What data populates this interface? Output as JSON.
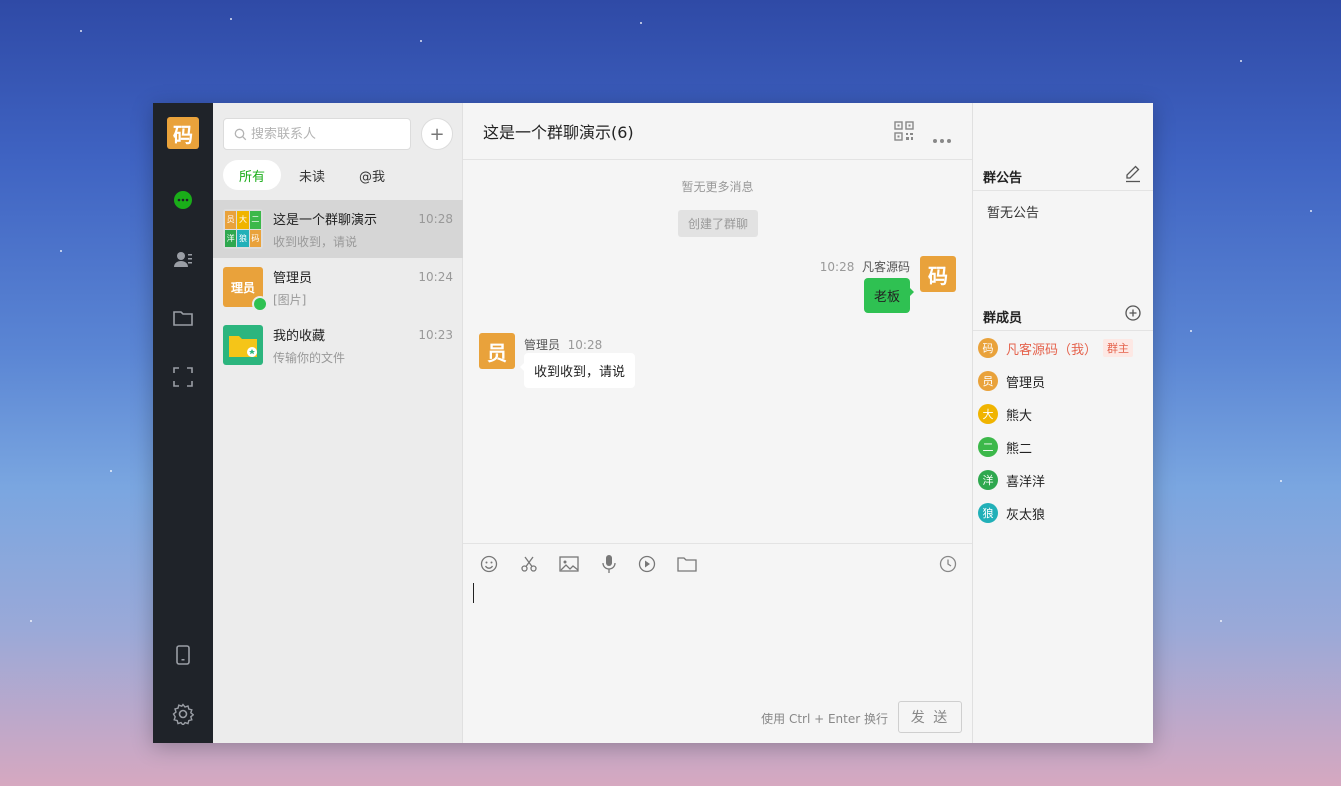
{
  "app": {
    "logo": "码"
  },
  "contacts": {
    "search_placeholder": "搜索联系人",
    "add": "+",
    "tabs": [
      "所有",
      "未读",
      "@我"
    ],
    "items": [
      {
        "name": "这是一个群聊演示",
        "preview": "收到收到，请说",
        "time": "10:28"
      },
      {
        "name": "管理员",
        "preview": "[图片]",
        "time": "10:24",
        "avatar_text": "理员"
      },
      {
        "name": "我的收藏",
        "preview": "传输你的文件",
        "time": "10:23"
      }
    ],
    "group_avatar_chars": [
      "员",
      "大",
      "二",
      "洋",
      "狼",
      "码"
    ]
  },
  "chat": {
    "title": "这是一个群聊演示(6)",
    "no_more": "暂无更多消息",
    "created": "创建了群聊",
    "messages": [
      {
        "time": "10:28",
        "sender": "凡客源码",
        "text": "老板",
        "avatar": "码"
      },
      {
        "sender": "管理员",
        "time": "10:28",
        "text": "收到收到，请说",
        "avatar": "员"
      }
    ],
    "hint": "使用 Ctrl + Enter 换行",
    "send": "发 送"
  },
  "side": {
    "announce_title": "群公告",
    "announce_text": "暂无公告",
    "members_title": "群成员",
    "members": [
      {
        "avatar": "码",
        "name": "凡客源码（我）",
        "badge": "群主",
        "color": "#e9a23b"
      },
      {
        "avatar": "员",
        "name": "管理员",
        "color": "#e9a23b"
      },
      {
        "avatar": "大",
        "name": "熊大",
        "color": "#f0b400"
      },
      {
        "avatar": "二",
        "name": "熊二",
        "color": "#3cb84a"
      },
      {
        "avatar": "洋",
        "name": "喜洋洋",
        "color": "#2fa84f"
      },
      {
        "avatar": "狼",
        "name": "灰太狼",
        "color": "#21b0b8"
      }
    ]
  },
  "colors": {
    "accent": "#1aad19",
    "bubble_mine": "#2fc152",
    "rail": "#1f2329",
    "avatar_orange": "#e9a23b"
  }
}
